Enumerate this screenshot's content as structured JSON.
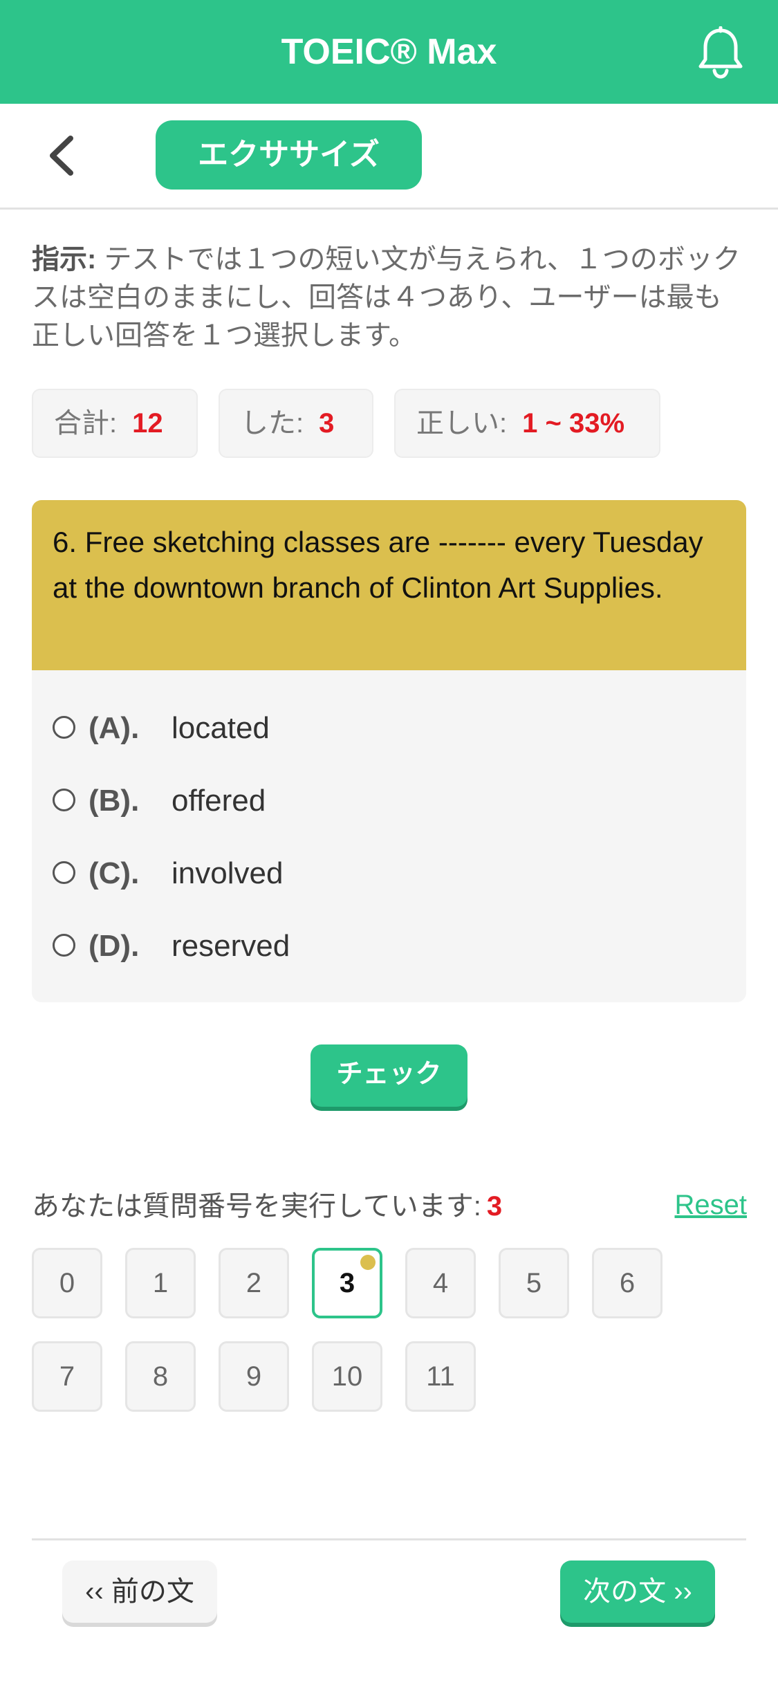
{
  "app": {
    "title": "TOEIC® Max"
  },
  "icons": {
    "notifications": "bell-icon",
    "back": "chevron-left-icon"
  },
  "colors": {
    "brand": "#2dc48a",
    "question_header": "#dbbf4e",
    "highlight_number": "#e31b23"
  },
  "nav": {
    "tab_label": "エクササイズ"
  },
  "instructions": {
    "label": "指示:",
    "text": " テストでは１つの短い文が与えられ、１つのボックスは空白のままにし、回答は４つあり、ユーザーは最も正しい回答を１つ選択します。"
  },
  "stats": {
    "total_label": "合計:",
    "total_value": "12",
    "done_label": "した:",
    "done_value": "3",
    "correct_label": "正しい:",
    "correct_value": "1 ~ 33%"
  },
  "question": {
    "text": "6. Free sketching classes are ------- every Tuesday at the downtown branch of Clinton Art Supplies.",
    "options": [
      {
        "letter": "(A).",
        "text": "located"
      },
      {
        "letter": "(B).",
        "text": "offered"
      },
      {
        "letter": "(C).",
        "text": "involved"
      },
      {
        "letter": "(D).",
        "text": "reserved"
      }
    ]
  },
  "check_button": "チェック",
  "progress": {
    "label": "あなたは質問番号を実行しています:",
    "current": "3",
    "reset": "Reset",
    "numbers": [
      "0",
      "1",
      "2",
      "3",
      "4",
      "5",
      "6",
      "7",
      "8",
      "9",
      "10",
      "11"
    ]
  },
  "footer": {
    "prev": "‹‹ 前の文",
    "next": "次の文 ››"
  }
}
